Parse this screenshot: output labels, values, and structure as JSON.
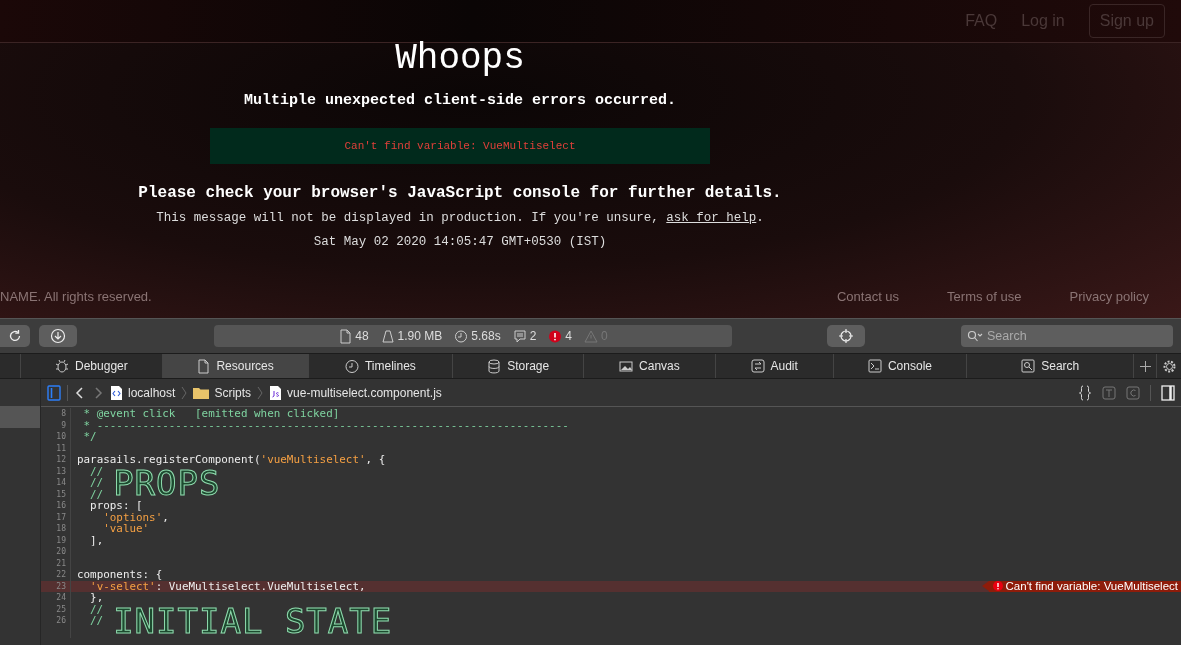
{
  "site": {
    "nav": [
      {
        "label": "FAQ",
        "kind": "link"
      },
      {
        "label": "Log in",
        "kind": "link"
      },
      {
        "label": "Sign up",
        "kind": "button"
      }
    ],
    "title": "Whoops",
    "subtitle": "Multiple unexpected client-side errors occurred.",
    "errors": [
      "Can't find variable: VueMultiselect"
    ],
    "advice": "Please check your browser's JavaScript console for further details.",
    "note": "This message will not be displayed in production. If you're unsure,",
    "note_link": "ask for help",
    "note_end": ".",
    "timestamp": "Sat May 02 2020 14:05:47 GMT+0530 (IST)",
    "footer": {
      "copyright": "NAME. All rights reserved.",
      "links": [
        "Contact us",
        "Terms of use",
        "Privacy policy"
      ]
    }
  },
  "toolbar": {
    "stats": [
      {
        "kind": "resources",
        "value": "48"
      },
      {
        "kind": "size",
        "value": "1.90 MB"
      },
      {
        "kind": "time",
        "value": "5.68s"
      },
      {
        "kind": "logs",
        "value": "2"
      },
      {
        "kind": "errors",
        "value": "4"
      },
      {
        "kind": "warnings",
        "value": "0"
      }
    ],
    "search": {
      "placeholder": "Search"
    }
  },
  "tabs": [
    {
      "label": "Debugger",
      "selected": false
    },
    {
      "label": "Resources",
      "selected": true
    },
    {
      "label": "Timelines",
      "selected": false
    },
    {
      "label": "Storage",
      "selected": false
    },
    {
      "label": "Canvas",
      "selected": false
    },
    {
      "label": "Audit",
      "selected": false
    },
    {
      "label": "Console",
      "selected": false
    },
    {
      "label": "Search",
      "selected": false
    }
  ],
  "breadcrumb": [
    "localhost",
    "Scripts",
    "vue-multiselect.component.js"
  ],
  "code": [
    {
      "kind": "line",
      "number": "8",
      "parts": [
        {
          "kind": "comment",
          "text": " * @event click   [emitted when clicked]"
        }
      ]
    },
    {
      "kind": "line",
      "number": "9",
      "parts": [
        {
          "kind": "comment",
          "text": " * ------------------------------------------------------------------------"
        }
      ]
    },
    {
      "kind": "line",
      "number": "10",
      "parts": [
        {
          "kind": "comment",
          "text": " */"
        }
      ]
    },
    {
      "kind": "line",
      "number": "11"
    },
    {
      "kind": "line",
      "number": "12",
      "parts": [
        {
          "kind": "plain",
          "text": "parasails.registerComponent("
        },
        {
          "kind": "string",
          "text": "'vueMultiselect'"
        },
        {
          "kind": "plain",
          "text": ", {"
        }
      ]
    },
    {
      "kind": "banner",
      "numbers": [
        "13",
        "14",
        "15"
      ],
      "prefixes": [
        "//",
        "//",
        "//"
      ],
      "title": "PROPS"
    },
    {
      "kind": "line",
      "number": "16",
      "parts": [
        {
          "kind": "plain",
          "text": "  props: ["
        }
      ]
    },
    {
      "kind": "line",
      "number": "17",
      "parts": [
        {
          "kind": "string",
          "text": "    'options'"
        },
        {
          "kind": "plain",
          "text": ","
        }
      ]
    },
    {
      "kind": "line",
      "number": "18",
      "parts": [
        {
          "kind": "string",
          "text": "    'value'"
        }
      ]
    },
    {
      "kind": "line",
      "number": "19",
      "parts": [
        {
          "kind": "plain",
          "text": "  ],"
        }
      ]
    },
    {
      "kind": "line",
      "number": "20"
    },
    {
      "kind": "line",
      "number": "21"
    },
    {
      "kind": "line",
      "number": "22",
      "parts": [
        {
          "kind": "plain",
          "text": "components: {"
        }
      ]
    },
    {
      "kind": "line",
      "number": "23",
      "parts": [
        {
          "kind": "string",
          "text": "  'v-select'"
        },
        {
          "kind": "plain",
          "text": ": VueMultiselect.VueMultiselect,"
        }
      ],
      "error": "Can't find variable: VueMultiselect"
    },
    {
      "kind": "line",
      "number": "24",
      "parts": [
        {
          "kind": "plain",
          "text": "  },"
        }
      ]
    },
    {
      "kind": "banner",
      "numbers": [
        "25",
        "26"
      ],
      "prefixes": [
        "//",
        "//"
      ],
      "title": "INITIAL STATE"
    }
  ]
}
